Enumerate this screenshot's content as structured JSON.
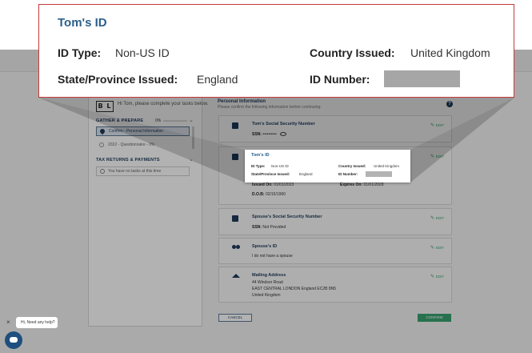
{
  "sidebar": {
    "logo": "B L",
    "greeting": "Hi Tom, please complete your tasks below.",
    "gather_heading": "GATHER & PREPARE",
    "progress_text": "0%",
    "progress_value": 0,
    "tasks": [
      {
        "label": "Confirm - Personal Information",
        "active": true
      },
      {
        "label": "2022 - Questionnaire - 0%",
        "active": false
      }
    ],
    "returns_heading": "TAX RETURNS & PAYMENTS",
    "no_tasks": "You have no tasks at this time"
  },
  "main": {
    "title": "Personal Information",
    "subtitle": "Please confirm the following information before continuing:",
    "cards": {
      "ssn": {
        "title": "Tom's Social Security Number",
        "label": "SSN:",
        "value": "••••••••••",
        "edit": "EDIT"
      },
      "id": {
        "edit": "EDIT",
        "issued_label": "Issued On:",
        "issued_value": "01/01/2023",
        "expires_label": "Expires On:",
        "expires_value": "01/01/2028",
        "dob_label": "D.O.B:",
        "dob_value": "02/15/1990"
      },
      "spouse_ssn": {
        "title": "Spouse's Social Security Number",
        "label": "SSN:",
        "value": "Not Provided",
        "edit": "EDIT"
      },
      "spouse_id": {
        "title": "Spouse's ID",
        "text": "I do not have a spouse",
        "edit": "EDIT"
      },
      "address": {
        "title": "Mailing Address",
        "line1": "44 Windsor Road",
        "line2": "EAST CENTRAL LONDON England EC2B 8N5",
        "line3": "United Kingdom",
        "edit": "EDIT"
      }
    },
    "cancel": "CANCEL",
    "confirm": "CONFIRM"
  },
  "tooltip": {
    "title": "Tom's ID",
    "id_type_label": "ID Type:",
    "id_type_value": "Non-US ID",
    "country_label": "Country Issued:",
    "country_value": "United Kingdom",
    "state_label": "State/Province Issued:",
    "state_value": "England",
    "id_number_label": "ID Number:"
  },
  "chat": {
    "text": "Hi, Need any help?",
    "close": "×"
  },
  "colors": {
    "accent": "#1e3a5c",
    "green": "#3aa371",
    "highlight_border": "#c43a3a"
  }
}
